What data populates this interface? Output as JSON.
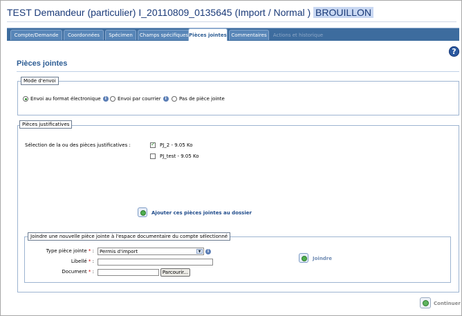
{
  "header": {
    "title": "TEST Demandeur (particulier)   I_20110809_0135645 (Import / Normal )",
    "status": "BROUILLON"
  },
  "tabs": [
    {
      "label": "Compte/Demande",
      "state": "normal"
    },
    {
      "label": "Coordonnées",
      "state": "normal"
    },
    {
      "label": "Spécimen",
      "state": "normal"
    },
    {
      "label": "Champs spécifiques",
      "state": "normal"
    },
    {
      "label": "Pièces jointes",
      "state": "active"
    },
    {
      "label": "Commentaires",
      "state": "normal"
    },
    {
      "label": "Actions et historique",
      "state": "disabled"
    }
  ],
  "help_icon": "?",
  "page_title": "Pièces jointes",
  "mode_envoi": {
    "legend": "Mode d'envoi",
    "options": [
      {
        "label": "Envoi au format électronique",
        "checked": true,
        "info": true
      },
      {
        "label": "Envoi par courrier",
        "checked": false,
        "info": true
      },
      {
        "label": "Pas de pièce jointe",
        "checked": false,
        "info": false
      }
    ]
  },
  "pieces": {
    "legend": "Pièces justificatives",
    "selection_label": "Sélection de la ou des pièces justificatives :",
    "files": [
      {
        "label": "PJ_2 - 9.05 Ko",
        "checked": true
      },
      {
        "label": "PJ_test - 9.05 Ko",
        "checked": false
      }
    ],
    "add_action": "Ajouter ces pièces jointes au dossier"
  },
  "joindre": {
    "legend": "Joindre une nouvelle pièce jointe à l'espace documentaire du compte sélectionné",
    "type_label": "Type pièce jointe",
    "type_value": "Permis d'import",
    "libelle_label": "Libellé",
    "libelle_value": "",
    "document_label": "Document",
    "document_value": "",
    "required_mark": "*",
    "colon": ":",
    "browse_label": "Parcourir...",
    "action_label": "Joindre"
  },
  "footer": {
    "continue_label": "Continuer"
  },
  "icons": {
    "info": "i"
  }
}
